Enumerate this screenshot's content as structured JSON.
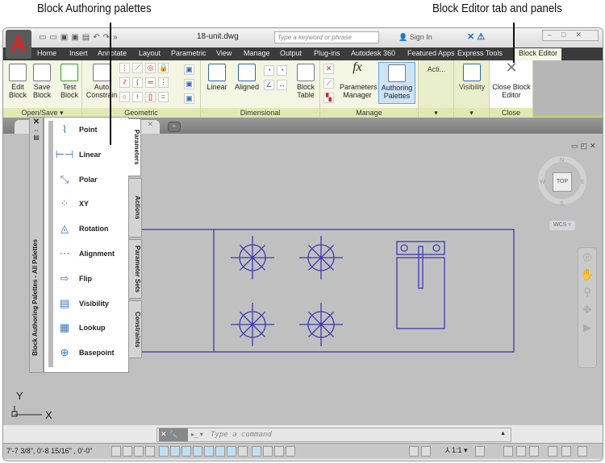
{
  "callouts": {
    "left": "Block Authoring palettes",
    "right": "Block Editor tab and panels"
  },
  "titlebar": {
    "filename": "18-unit.dwg",
    "search_placeholder": "Type a keyword or phrase",
    "sign_in": "Sign In"
  },
  "menu_tabs": [
    "Home",
    "Insert",
    "Annotate",
    "Layout",
    "Parametric",
    "View",
    "Manage",
    "Output",
    "Plug-ins",
    "Autodesk 360",
    "Featured Apps",
    "Express Tools",
    "Block Editor"
  ],
  "active_tab": "Block Editor",
  "ribbon": {
    "open_save": {
      "title": "Open/Save",
      "edit": "Edit Block",
      "save": "Save Block",
      "test": "Test Block"
    },
    "geometric": {
      "title": "Geometric",
      "auto": "Auto Constrain"
    },
    "dimensional": {
      "title": "Dimensional",
      "linear": "Linear",
      "aligned": "Aligned",
      "table": "Block Table"
    },
    "manage": {
      "title": "Manage",
      "params": "Parameters Manager",
      "authoring": "Authoring Palettes"
    },
    "actions": {
      "title": "Acti..."
    },
    "visibility": {
      "label": "Visibility"
    },
    "close": {
      "title": "Close",
      "label": "Close Block Editor"
    }
  },
  "palette": {
    "title": "Block Authoring Palettes - All Palettes",
    "items": [
      "Point",
      "Linear",
      "Polar",
      "XY",
      "Rotation",
      "Alignment",
      "Flip",
      "Visibility",
      "Lookup",
      "Basepoint"
    ],
    "tabs": [
      "Parameters",
      "Actions",
      "Parameter Sets",
      "Constraints"
    ],
    "active_tab": "Parameters"
  },
  "viewcube": {
    "face": "TOP",
    "n": "N",
    "s": "S",
    "e": "E",
    "w": "W",
    "wcs": "WCS"
  },
  "ucs": {
    "x": "X",
    "y": "Y"
  },
  "command": {
    "placeholder": "Type a command"
  },
  "status": {
    "coords": "7'-7 3/8\",  0'-8 15/16\" , 0'-0\"",
    "scale": "1:1"
  },
  "colors": {
    "drawing": "#3a3ab4",
    "ribbon": "#f4f6e4",
    "panel_title": "#e1e8b4",
    "canvas": "#c0c0c0"
  }
}
